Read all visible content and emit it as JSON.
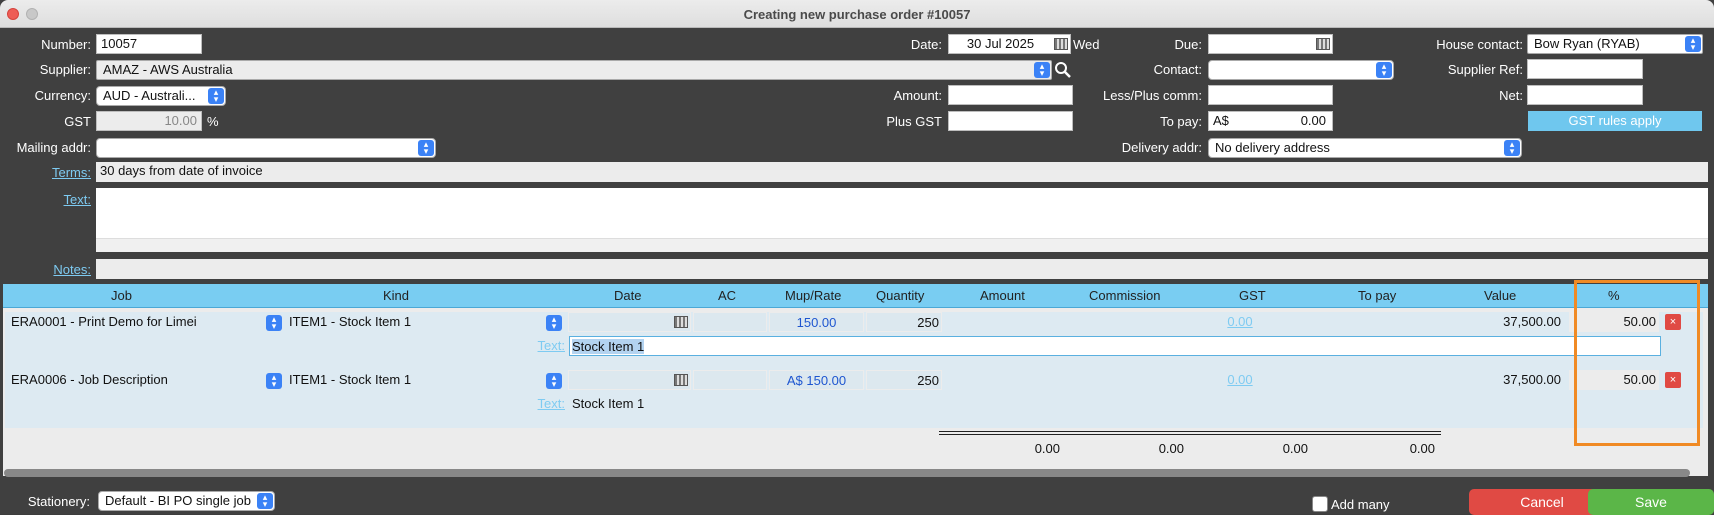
{
  "window": {
    "title": "Creating new purchase order #10057"
  },
  "header": {
    "number_label": "Number:",
    "number_value": "10057",
    "date_label": "Date:",
    "date_value": "30 Jul 2025",
    "date_day": "Wed",
    "due_label": "Due:",
    "due_value": "",
    "house_contact_label": "House contact:",
    "house_contact_value": "Bow Ryan (RYAB)",
    "supplier_label": "Supplier:",
    "supplier_value": "AMAZ - AWS Australia",
    "contact_label": "Contact:",
    "contact_value": "",
    "supplier_ref_label": "Supplier Ref:",
    "supplier_ref_value": "",
    "currency_label": "Currency:",
    "currency_value": "AUD - Australi...",
    "amount_label": "Amount:",
    "amount_value": "",
    "less_plus_label": "Less/Plus comm:",
    "less_plus_value": "",
    "net_label": "Net:",
    "net_value": "",
    "gst_label": "GST",
    "gst_value": "10.00",
    "gst_unit": "%",
    "plus_gst_label": "Plus GST",
    "plus_gst_value": "",
    "to_pay_label": "To pay:",
    "to_pay_currency": "A$",
    "to_pay_value": "0.00",
    "gst_rules_button": "GST rules apply",
    "mailing_label": "Mailing addr:",
    "mailing_value": "",
    "delivery_label": "Delivery addr:",
    "delivery_value": "No delivery address",
    "terms_label": "Terms:",
    "terms_value": "30 days from date of invoice",
    "text_label": "Text:",
    "text_value": "",
    "notes_label": "Notes:",
    "notes_value": ""
  },
  "grid": {
    "columns": [
      "Job",
      "Kind",
      "Date",
      "AC",
      "Mup/Rate",
      "Quantity",
      "Amount",
      "Commission",
      "GST",
      "To pay",
      "Value",
      "%"
    ],
    "rows": [
      {
        "job": "ERA0001 - Print Demo for Limei",
        "kind": "ITEM1 -  Stock Item 1",
        "date": "",
        "ac": "",
        "rate": "150.00",
        "quantity": "250",
        "gst": "0.00",
        "value": "37,500.00",
        "percent": "50.00",
        "text_label": "Text:",
        "text": "Stock Item 1",
        "delete": "×"
      },
      {
        "job": "ERA0006 - Job Description",
        "kind": "ITEM1 -  Stock Item 1",
        "date": "",
        "ac": "",
        "rate": "A$ 150.00",
        "quantity": "250",
        "gst": "0.00",
        "value": "37,500.00",
        "percent": "50.00",
        "text_label": "Text:",
        "text": "Stock Item 1",
        "delete": "×"
      }
    ],
    "totals": {
      "amount": "0.00",
      "commission": "0.00",
      "gst": "0.00",
      "to_pay": "0.00"
    }
  },
  "footer": {
    "stationery_label": "Stationery:",
    "stationery_value": "Default - BI PO single job",
    "add_many_label": "Add many",
    "cancel_label": "Cancel",
    "save_label": "Save"
  },
  "colors": {
    "accent": "#79cdf2",
    "save": "#5bb648",
    "cancel": "#e04a44",
    "highlight": "#f08a24"
  }
}
